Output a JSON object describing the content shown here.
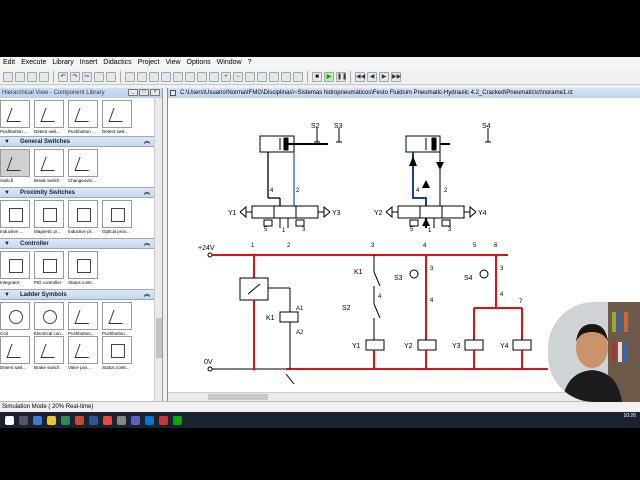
{
  "menubar": {
    "items": [
      "Edit",
      "Execute",
      "Library",
      "Insert",
      "Didactics",
      "Project",
      "View",
      "Options",
      "Window",
      "?"
    ]
  },
  "library": {
    "title": "Hierarchical View - Component Library",
    "top_tiles": [
      "Pushbutton ...",
      "Detent swit...",
      "Pushbutton ...",
      "Detent swit..."
    ],
    "categories": [
      {
        "name": "General Switches",
        "tiles": [
          "Switch",
          "Break switch",
          "Changeover..."
        ]
      },
      {
        "name": "Proximity Switches",
        "tiles": [
          "Inductive ...",
          "Magnetic pr...",
          "Inductive pr...",
          "Optical prox..."
        ]
      },
      {
        "name": "Controller",
        "tiles": [
          "Integrator",
          "PID controller",
          "Status contr..."
        ]
      },
      {
        "name": "Ladder Symbols",
        "tiles": [
          "Coil",
          "Electrical con...",
          "Pushbutton...",
          "Pushbutton...",
          "Detent swit...",
          "Brake switch",
          "Valve pos...",
          "Status contr..."
        ]
      }
    ]
  },
  "drawing": {
    "title": "C:\\Users\\Usuario\\Norma\\IFMG\\Disciplinas\\~Sistemas hidropneumáticos\\Festo Fluidsim Pneumatic-Hydraulic 4.2_Cracked\\Pneumatic\\ct\\norame1.ct",
    "labels": {
      "s2": "S2",
      "s3": "S3",
      "s4": "S4",
      "y1": "Y1",
      "y2": "Y2",
      "y3": "Y3",
      "y4": "Y4",
      "k1": "K1",
      "v24": "+24V",
      "v0": "0V",
      "a1": "A1",
      "a2": "A2",
      "n1": "1",
      "n2": "2",
      "n3": "3",
      "n4": "4",
      "n5": "5",
      "n6": "6",
      "n7": "7"
    }
  },
  "status": {
    "text": "Simulation Mode ( 20% Real-time)"
  },
  "taskbar": {
    "time": "10:26"
  },
  "colors": {
    "active_wire": "#e01010",
    "idle_wire": "#000000",
    "air_line": "#1a5cd8",
    "title_bar": "#bfd2ec"
  }
}
